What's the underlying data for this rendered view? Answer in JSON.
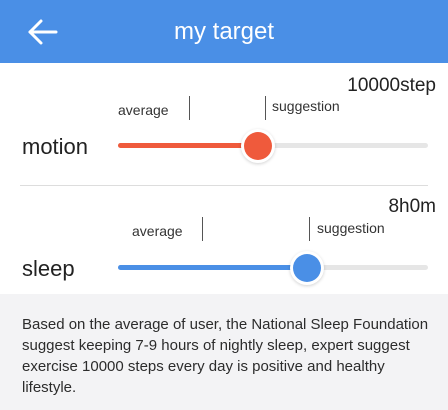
{
  "header": {
    "title": "my target",
    "back_icon": "arrow-left-icon",
    "background_color": "#4a8fe6"
  },
  "motion": {
    "label": "motion",
    "goal_value": "10000step",
    "average_label": "average",
    "suggestion_label": "suggestion",
    "accent_color": "#ef5a3c",
    "slider_level": 0.45
  },
  "sleep": {
    "label": "sleep",
    "goal_value": "8h0m",
    "average_label": "average",
    "suggestion_label": "suggestion",
    "accent_color": "#4a8fe6",
    "slider_level": 0.61
  },
  "footer": {
    "text": "Based on the average of user, the National Sleep Foundation suggest keeping 7-9 hours of nightly sleep, expert suggest exercise 10000 steps every day is positive and healthy lifestyle."
  }
}
